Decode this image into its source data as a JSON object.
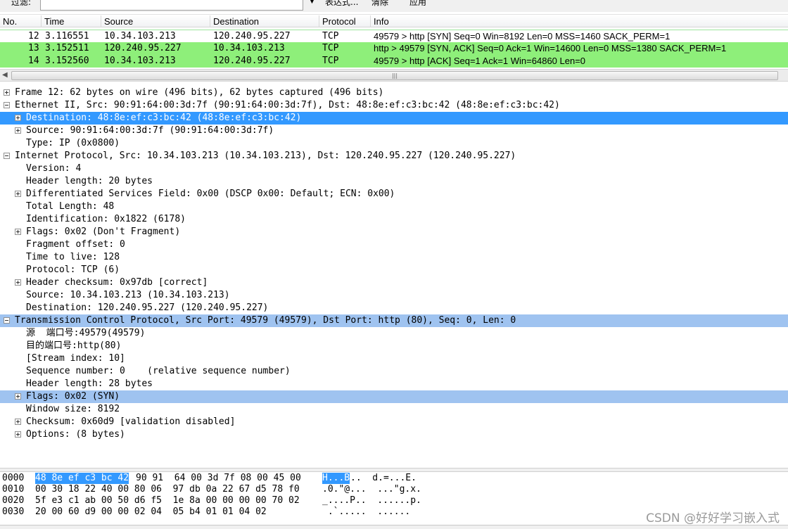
{
  "filter": {
    "label": "过滤:",
    "value": "",
    "expression_label": "表达式...",
    "clear_label": "清除",
    "apply_label": "应用"
  },
  "list": {
    "columns": [
      "No.",
      "Time",
      "Source",
      "Destination",
      "Protocol",
      "Info"
    ],
    "rows": [
      {
        "no": "12",
        "time": "3.116551",
        "src": "10.34.103.213",
        "dst": "120.240.95.227",
        "proto": "TCP",
        "info": "49579 > http [SYN] Seq=0 Win=8192 Len=0 MSS=1460 SACK_PERM=1"
      },
      {
        "no": "13",
        "time": "3.152511",
        "src": "120.240.95.227",
        "dst": "10.34.103.213",
        "proto": "TCP",
        "info": "http > 49579 [SYN, ACK] Seq=0 Ack=1 Win=14600 Len=0 MSS=1380 SACK_PERM=1"
      },
      {
        "no": "14",
        "time": "3.152560",
        "src": "10.34.103.213",
        "dst": "120.240.95.227",
        "proto": "TCP",
        "info": "49579 > http [ACK] Seq=1 Ack=1 Win=64860 Len=0"
      }
    ],
    "row_color": "#8eef7a"
  },
  "tree": [
    {
      "text": "Frame 12: 62 bytes on wire (496 bits), 62 bytes captured (496 bits)"
    },
    {
      "text": "Ethernet II, Src: 90:91:64:00:3d:7f (90:91:64:00:3d:7f), Dst: 48:8e:ef:c3:bc:42 (48:8e:ef:c3:bc:42)"
    },
    {
      "text": "Destination: 48:8e:ef:c3:bc:42 (48:8e:ef:c3:bc:42)"
    },
    {
      "text": "Source: 90:91:64:00:3d:7f (90:91:64:00:3d:7f)"
    },
    {
      "text": "Type: IP (0x0800)"
    },
    {
      "text": "Internet Protocol, Src: 10.34.103.213 (10.34.103.213), Dst: 120.240.95.227 (120.240.95.227)"
    },
    {
      "text": "Version: 4"
    },
    {
      "text": "Header length: 20 bytes"
    },
    {
      "text": "Differentiated Services Field: 0x00 (DSCP 0x00: Default; ECN: 0x00)"
    },
    {
      "text": "Total Length: 48"
    },
    {
      "text": "Identification: 0x1822 (6178)"
    },
    {
      "text": "Flags: 0x02 (Don't Fragment)"
    },
    {
      "text": "Fragment offset: 0"
    },
    {
      "text": "Time to live: 128"
    },
    {
      "text": "Protocol: TCP (6)"
    },
    {
      "text": "Header checksum: 0x97db [correct]"
    },
    {
      "text": "Source: 10.34.103.213 (10.34.103.213)"
    },
    {
      "text": "Destination: 120.240.95.227 (120.240.95.227)"
    },
    {
      "text": "Transmission Control Protocol, Src Port: 49579 (49579), Dst Port: http (80), Seq: 0, Len: 0"
    },
    {
      "text": "源  端口号:49579(49579)"
    },
    {
      "text": "目的端口号:http(80)"
    },
    {
      "text": "[Stream index: 10]"
    },
    {
      "text": "Sequence number: 0    (relative sequence number)"
    },
    {
      "text": "Header length: 28 bytes"
    },
    {
      "text": "Flags: 0x02 (SYN)"
    },
    {
      "text": "Window size: 8192"
    },
    {
      "text": "Checksum: 0x60d9 [validation disabled]"
    },
    {
      "text": "Options: (8 bytes)"
    }
  ],
  "bytes": [
    {
      "offset": "0000",
      "hex_sel": "48 8e ef c3 bc 42",
      "hex_rest": "90 91  64 00 3d 7f 08 00 45 00",
      "ascii_sel": "H...B",
      "ascii_rest": "..  d.=...E."
    },
    {
      "offset": "0010",
      "hex_sel": "",
      "hex_rest": "00 30 18 22 40 00 80 06  97 db 0a 22 67 d5 78 f0",
      "ascii_sel": "",
      "ascii_rest": ".0.\"@...  ...\"g.x."
    },
    {
      "offset": "0020",
      "hex_sel": "",
      "hex_rest": "5f e3 c1 ab 00 50 d6 f5  1e 8a 00 00 00 00 70 02",
      "ascii_sel": "",
      "ascii_rest": "_....P..  ......p."
    },
    {
      "offset": "0030",
      "hex_sel": "",
      "hex_rest": "20 00 60 d9 00 00 02 04  05 b4 01 01 04 02",
      "ascii_sel": "",
      "ascii_rest": " .`.....  ......"
    }
  ],
  "watermark": "CSDN @好好学习嵌入式"
}
